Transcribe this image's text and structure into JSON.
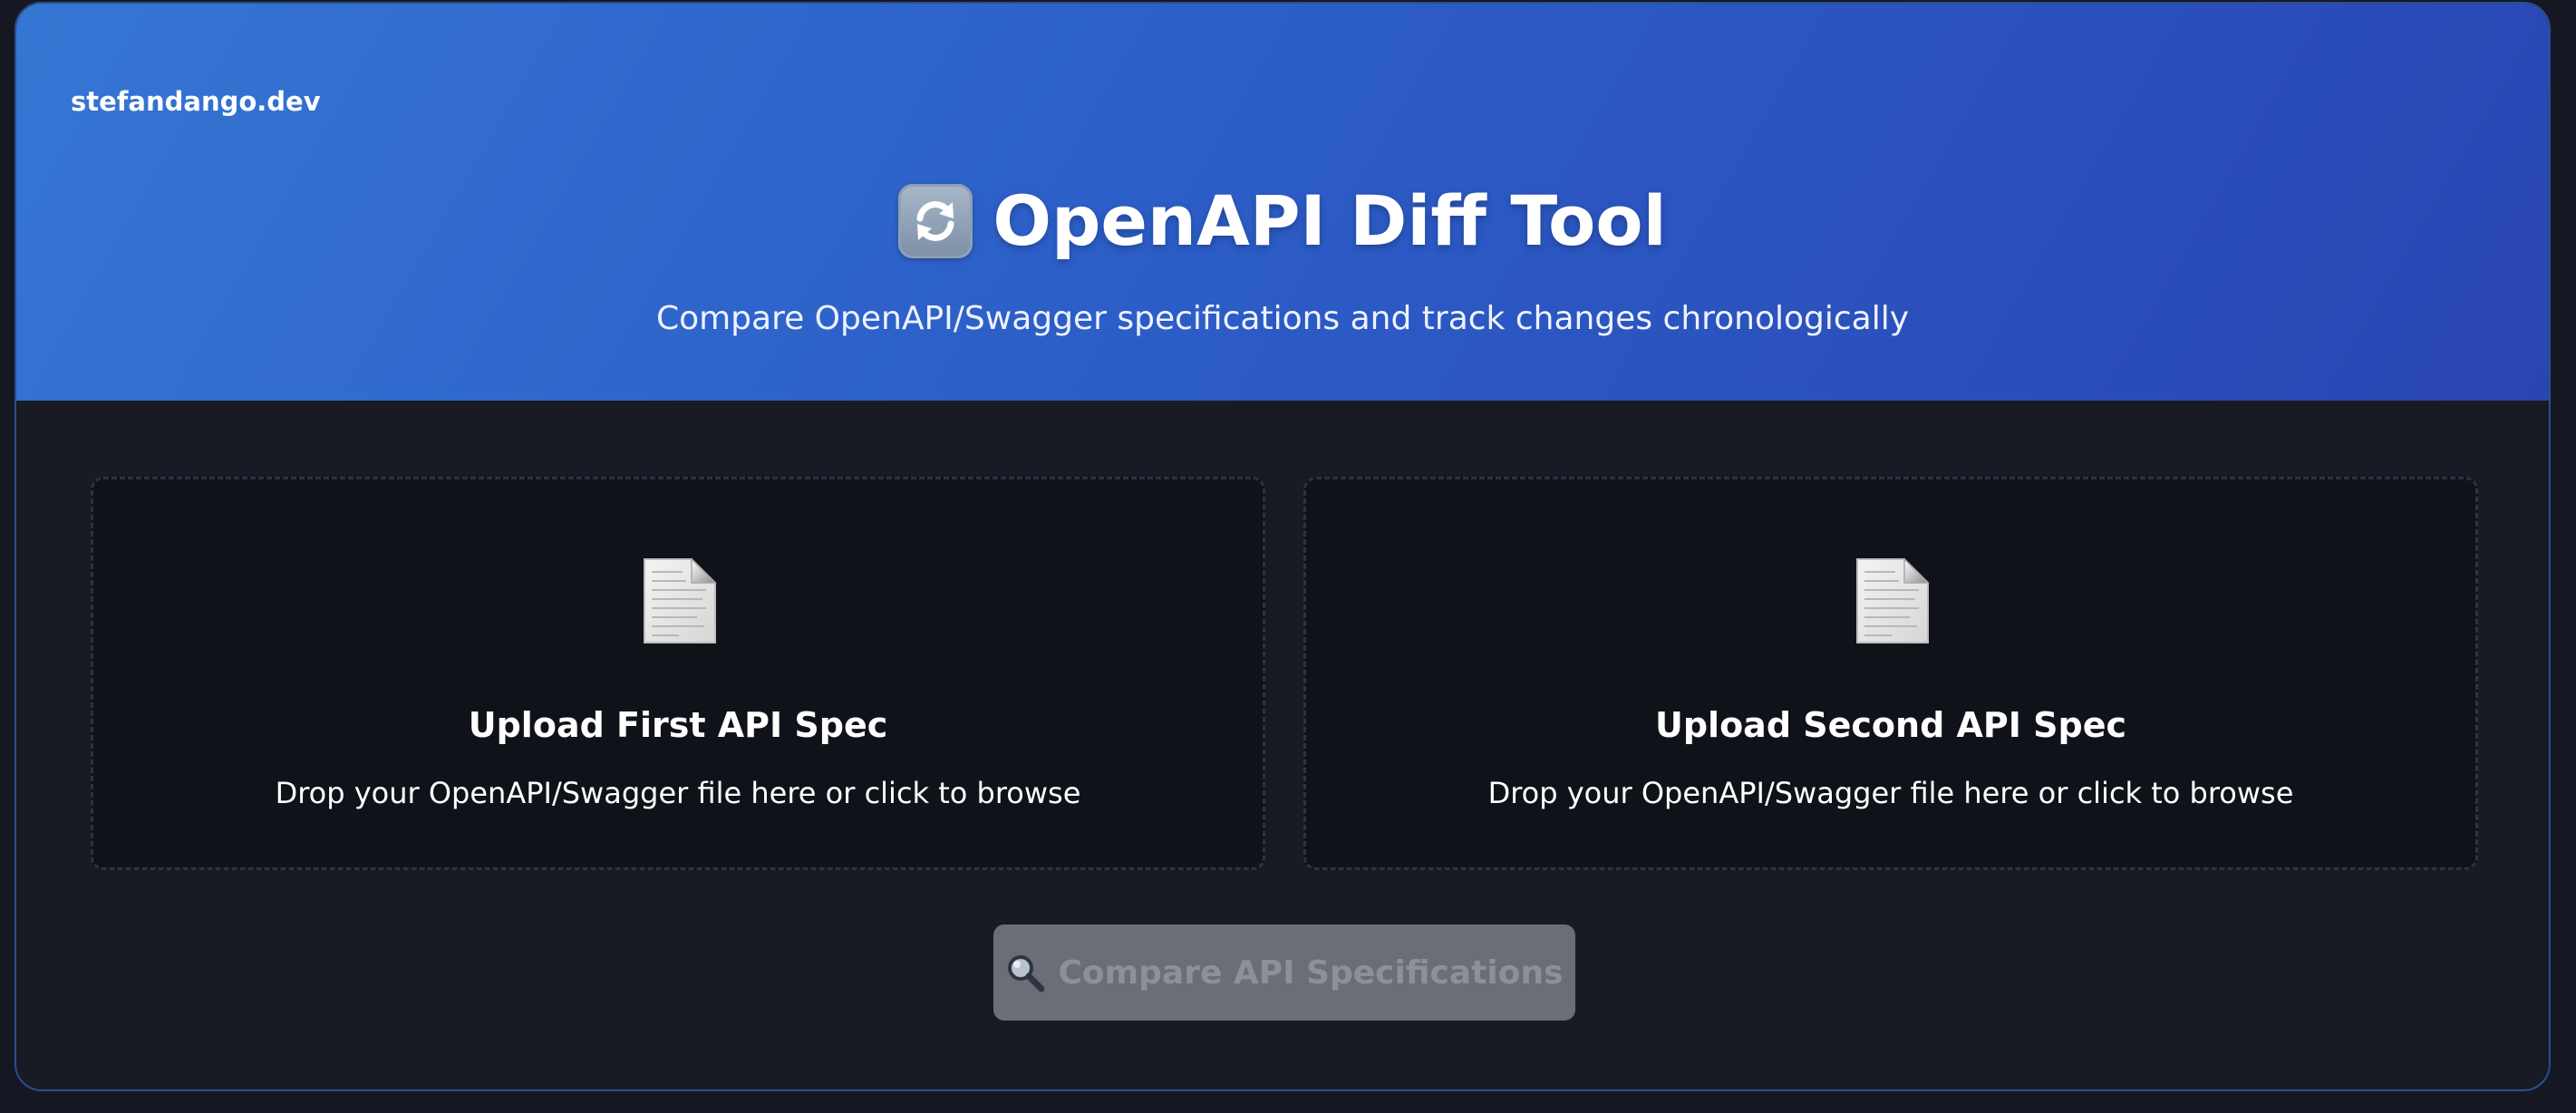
{
  "header": {
    "brand": "stefandango.dev",
    "title": "OpenAPI Diff Tool",
    "title_icon": "arrows-sync-icon",
    "subtitle": "Compare OpenAPI/Swagger specifications and track changes chronologically"
  },
  "upload": {
    "first": {
      "icon": "document-icon",
      "title": "Upload First API Spec",
      "hint": "Drop your OpenAPI/Swagger file here or click to browse"
    },
    "second": {
      "icon": "document-icon",
      "title": "Upload Second API Spec",
      "hint": "Drop your OpenAPI/Swagger file here or click to browse"
    }
  },
  "actions": {
    "compare_icon": "magnifier-icon",
    "compare_label": "Compare API Specifications",
    "compare_disabled": true
  },
  "colors": {
    "header_gradient_start": "#3576d3",
    "header_gradient_end": "#2a45b2",
    "body_background": "#181b23",
    "dropzone_background": "#10121a",
    "button_disabled": "#6b6e77"
  }
}
